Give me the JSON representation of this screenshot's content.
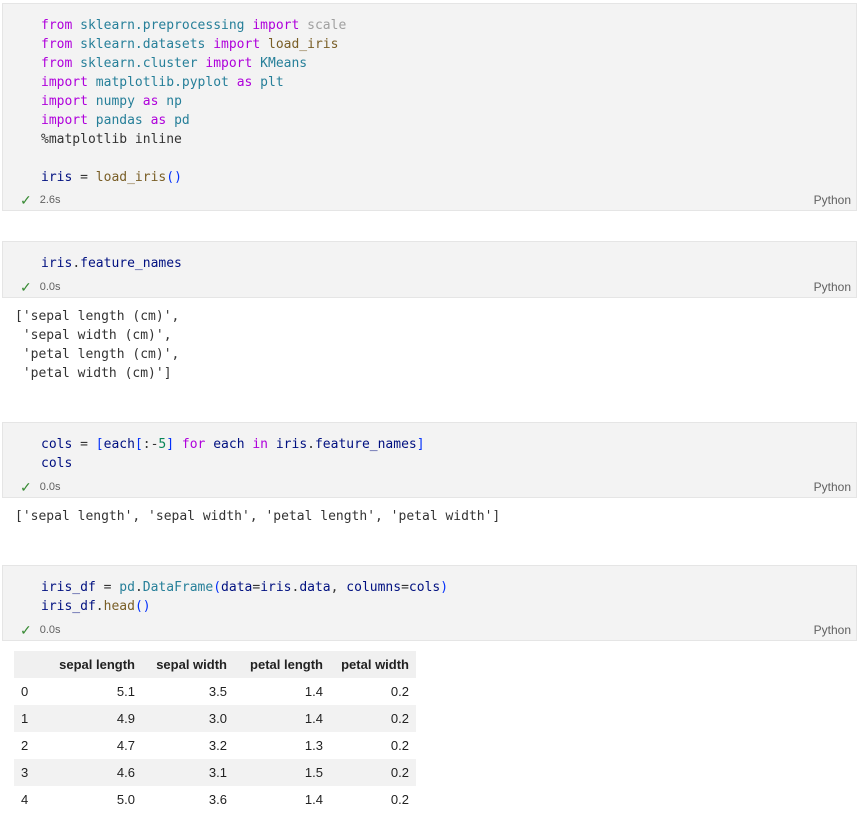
{
  "cells": [
    {
      "code_lines": [
        "from sklearn.preprocessing import scale",
        "from sklearn.datasets import load_iris",
        "from sklearn.cluster import KMeans",
        "import matplotlib.pyplot as plt",
        "import numpy as np",
        "import pandas as pd",
        "%matplotlib inline",
        "",
        "iris = load_iris()"
      ],
      "time": "2.6s",
      "language": "Python"
    },
    {
      "code_lines": [
        "iris.feature_names"
      ],
      "time": "0.0s",
      "language": "Python",
      "output_lines": [
        "['sepal length (cm)',",
        " 'sepal width (cm)',",
        " 'petal length (cm)',",
        " 'petal width (cm)']"
      ]
    },
    {
      "code_lines": [
        "cols = [each[:-5] for each in iris.feature_names]",
        "cols"
      ],
      "time": "0.0s",
      "language": "Python",
      "output_lines": [
        "['sepal length', 'sepal width', 'petal length', 'petal width']"
      ]
    },
    {
      "code_lines": [
        "iris_df = pd.DataFrame(data=iris.data, columns=cols)",
        "iris_df.head()"
      ],
      "time": "0.0s",
      "language": "Python"
    }
  ],
  "dataframe": {
    "columns": [
      "",
      "sepal length",
      "sepal width",
      "petal length",
      "petal width"
    ],
    "rows": [
      [
        "0",
        "5.1",
        "3.5",
        "1.4",
        "0.2"
      ],
      [
        "1",
        "4.9",
        "3.0",
        "1.4",
        "0.2"
      ],
      [
        "2",
        "4.7",
        "3.2",
        "1.3",
        "0.2"
      ],
      [
        "3",
        "4.6",
        "3.1",
        "1.5",
        "0.2"
      ],
      [
        "4",
        "5.0",
        "3.6",
        "1.4",
        "0.2"
      ]
    ]
  },
  "icons": {
    "success": "checkmark-icon"
  },
  "colors": {
    "success": "#388a34",
    "cell_bg": "#f3f3f3",
    "keyword": "#af00db",
    "module": "#267f99"
  }
}
